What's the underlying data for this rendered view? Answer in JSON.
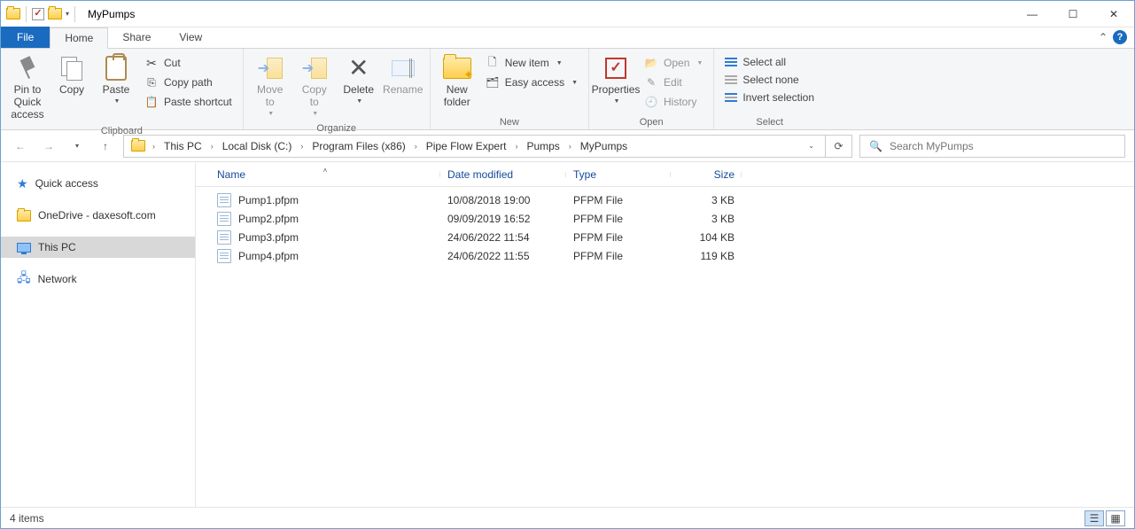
{
  "window": {
    "title": "MyPumps"
  },
  "tabs": {
    "file": "File",
    "home": "Home",
    "share": "Share",
    "view": "View"
  },
  "ribbon": {
    "clipboard": {
      "label": "Clipboard",
      "pin": "Pin to Quick\naccess",
      "copy": "Copy",
      "paste": "Paste",
      "cut": "Cut",
      "copy_path": "Copy path",
      "paste_shortcut": "Paste shortcut"
    },
    "organize": {
      "label": "Organize",
      "move_to": "Move\nto",
      "copy_to": "Copy\nto",
      "delete": "Delete",
      "rename": "Rename"
    },
    "new": {
      "label": "New",
      "new_folder": "New\nfolder",
      "new_item": "New item",
      "easy_access": "Easy access"
    },
    "open": {
      "label": "Open",
      "properties": "Properties",
      "open": "Open",
      "edit": "Edit",
      "history": "History"
    },
    "select": {
      "label": "Select",
      "select_all": "Select all",
      "select_none": "Select none",
      "invert": "Invert selection"
    }
  },
  "breadcrumb": [
    "This PC",
    "Local Disk (C:)",
    "Program Files (x86)",
    "Pipe Flow Expert",
    "Pumps",
    "MyPumps"
  ],
  "search": {
    "placeholder": "Search MyPumps"
  },
  "sidebar": {
    "quick_access": "Quick access",
    "onedrive": "OneDrive - daxesoft.com",
    "this_pc": "This PC",
    "network": "Network"
  },
  "columns": {
    "name": "Name",
    "date": "Date modified",
    "type": "Type",
    "size": "Size"
  },
  "files": [
    {
      "name": "Pump1.pfpm",
      "date": "10/08/2018 19:00",
      "type": "PFPM File",
      "size": "3 KB"
    },
    {
      "name": "Pump2.pfpm",
      "date": "09/09/2019 16:52",
      "type": "PFPM File",
      "size": "3 KB"
    },
    {
      "name": "Pump3.pfpm",
      "date": "24/06/2022 11:54",
      "type": "PFPM File",
      "size": "104 KB"
    },
    {
      "name": "Pump4.pfpm",
      "date": "24/06/2022 11:55",
      "type": "PFPM File",
      "size": "119 KB"
    }
  ],
  "status": {
    "count": "4 items"
  }
}
